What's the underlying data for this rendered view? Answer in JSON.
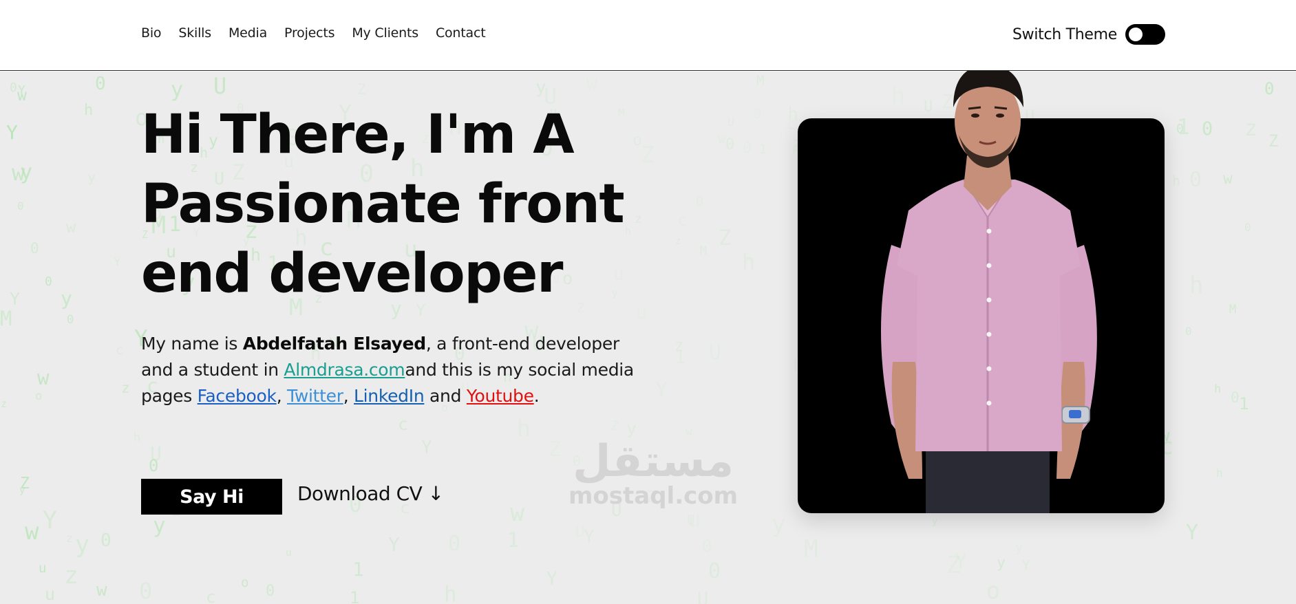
{
  "nav": {
    "items": [
      "Bio",
      "Skills",
      "Media",
      "Projects",
      "My Clients",
      "Contact"
    ]
  },
  "theme": {
    "label": "Switch Theme",
    "dark_mode_on": false
  },
  "hero": {
    "headline": "Hi There, I'm A Passionate front end developer",
    "bio": {
      "intro": "My name is ",
      "name": "Abdelfatah Elsayed",
      "after_name": ", a front-end developer and a student in ",
      "school": "Almdrasa.com",
      "after_school": "and this is my social media pages ",
      "facebook": "Facebook",
      "sep1": ", ",
      "twitter": "Twitter",
      "sep2": ", ",
      "linkedin": "LinkedIn",
      "and": " and ",
      "youtube": "Youtube",
      "end": "."
    },
    "say_hi_label": "Say Hi",
    "download_cv_label": "Download CV ↓"
  },
  "watermark": {
    "arabic": "مستقل",
    "latin": "mostaql.com"
  },
  "colors": {
    "almdrasa": "#1a9e8f",
    "facebook": "#1a5fc4",
    "twitter": "#3a8fd6",
    "linkedin": "#1560b0",
    "youtube": "#e01010",
    "matrix_green": "#8fe08f"
  },
  "icons": {
    "portrait": "person-photo",
    "theme_toggle": "toggle-switch-icon"
  }
}
